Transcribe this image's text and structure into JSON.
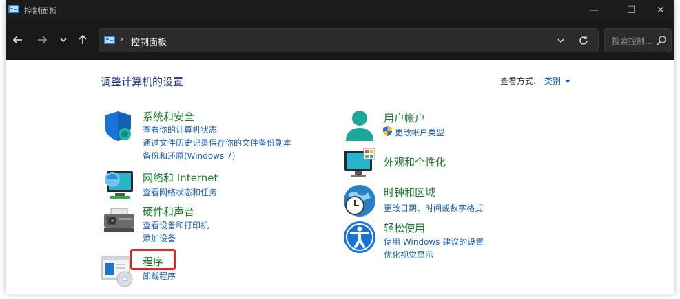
{
  "window": {
    "title": "控制面板",
    "controls": {
      "minimize": "—",
      "maximize": "☐",
      "close": "✕"
    }
  },
  "nav": {
    "back_icon": "arrow-left-icon",
    "forward_icon": "arrow-right-icon",
    "recent_icon": "chevron-down-icon",
    "up_icon": "arrow-up-icon",
    "breadcrumb_sep": "›",
    "breadcrumb": "控制面板",
    "search_placeholder": "搜索控制..."
  },
  "page": {
    "heading": "调整计算机的设置",
    "view_by_label": "查看方式:",
    "view_by_value": "类别"
  },
  "categories": [
    {
      "title": "系统和安全",
      "links": [
        "查看你的计算机状态",
        "通过文件历史记录保存你的文件备份副本",
        "备份和还原(Windows 7)"
      ]
    },
    {
      "title": "网络和 Internet",
      "links": [
        "查看网络状态和任务"
      ]
    },
    {
      "title": "硬件和声音",
      "links": [
        "查看设备和打印机",
        "添加设备"
      ]
    },
    {
      "title": "程序",
      "links": [
        "卸载程序"
      ]
    },
    {
      "title": "用户帐户",
      "links": [
        "更改帐户类型"
      ]
    },
    {
      "title": "外观和个性化",
      "links": []
    },
    {
      "title": "时钟和区域",
      "links": [
        "更改日期、时间或数字格式"
      ]
    },
    {
      "title": "轻松使用",
      "links": [
        "使用 Windows 建议的设置",
        "优化视觉显示"
      ]
    }
  ],
  "colors": {
    "category_title": "#1b7a2d",
    "link": "#1a5fb4",
    "heading": "#1e3287",
    "highlight": "#e02424"
  }
}
